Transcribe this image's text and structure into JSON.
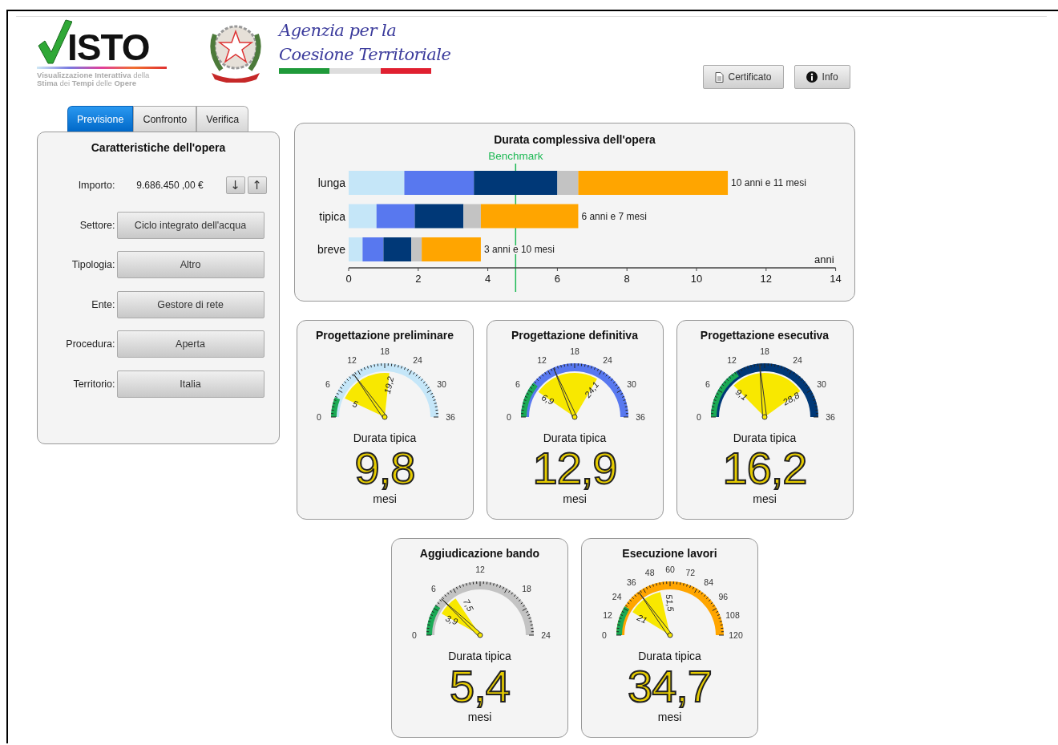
{
  "header": {
    "logo": {
      "wordmark": "ISTO",
      "lines": [
        "**Visualizzazione Interattiva** della",
        "**Stima** dei **Tempi** delle **Opere**"
      ]
    },
    "agency": [
      "Agenzia per la",
      "Coesione Territoriale"
    ],
    "buttons": [
      {
        "label": "Certificato"
      },
      {
        "label": "Info"
      }
    ]
  },
  "tabs": [
    {
      "label": "Previsione",
      "selected": true
    },
    {
      "label": "Confronto",
      "selected": false
    },
    {
      "label": "Verifica",
      "selected": false
    }
  ],
  "panel": {
    "title": "Caratteristiche dell'opera",
    "fields": [
      {
        "kind": "amount",
        "label": "Importo:",
        "value": "9.686.450 ,00 €",
        "steppers": [
          "↓",
          "↑"
        ]
      },
      {
        "kind": "select",
        "label": "Settore:",
        "value": "Ciclo integrato dell'acqua"
      },
      {
        "kind": "select",
        "label": "Tipologia:",
        "value": "Altro"
      },
      {
        "kind": "select",
        "label": "Ente:",
        "value": "Gestore di rete"
      },
      {
        "kind": "select",
        "label": "Procedura:",
        "value": "Aperta"
      },
      {
        "kind": "select",
        "label": "Territorio:",
        "value": "Italia"
      }
    ]
  },
  "overview": {
    "title": "Durata complessiva dell'opera",
    "chart_data": {
      "type": "bar",
      "orientation": "horizontal",
      "stacked": true,
      "xlabel": "anni",
      "categories": [
        "lunga",
        "tipica",
        "breve"
      ],
      "xlim": [
        0,
        14
      ],
      "xticks": [
        0,
        2,
        4,
        6,
        8,
        10,
        12,
        14
      ],
      "series": [
        {
          "color": "#c5e6f8",
          "values": [
            1.6,
            0.8,
            0.4
          ]
        },
        {
          "color": "#5878ef",
          "values": [
            2.0,
            1.1,
            0.6
          ]
        },
        {
          "color": "#003877",
          "values": [
            2.4,
            1.4,
            0.8
          ]
        },
        {
          "color": "#c3c3c3",
          "values": [
            0.6,
            0.5,
            0.3
          ]
        },
        {
          "color": "#ffa500",
          "values": [
            4.3,
            2.8,
            1.7
          ]
        }
      ],
      "value_labels": [
        "10 anni e 11 mesi",
        "6 anni e 7 mesi",
        "3 anni e 10 mesi"
      ],
      "ref_lines": [
        {
          "axis": "x",
          "value": 4.8,
          "label": "Benchmark"
        }
      ]
    }
  },
  "gauges": [
    {
      "title": "Progettazione preliminare",
      "color": "#c5e6f8",
      "ticks": [
        "0",
        "6",
        "12",
        "18",
        "24",
        "30",
        "36"
      ],
      "range": [
        "5",
        "19,2"
      ],
      "caption": "Durata tipica",
      "value": "9,8",
      "unit": "mesi"
    },
    {
      "title": "Progettazione definitiva",
      "color": "#5878ef",
      "ticks": [
        "0",
        "6",
        "12",
        "18",
        "24",
        "30",
        "36"
      ],
      "range": [
        "6,9",
        "24,1"
      ],
      "caption": "Durata tipica",
      "value": "12,9",
      "unit": "mesi"
    },
    {
      "title": "Progettazione esecutiva",
      "color": "#003877",
      "ticks": [
        "0",
        "6",
        "12",
        "18",
        "24",
        "30",
        "36"
      ],
      "range": [
        "9,1",
        "28,8"
      ],
      "caption": "Durata tipica",
      "value": "16,2",
      "unit": "mesi"
    },
    {
      "title": "Aggiudicazione bando",
      "color": "#c3c3c3",
      "ticks": [
        "0",
        "6",
        "12",
        "18",
        "24"
      ],
      "range": [
        "3,9",
        "7,5"
      ],
      "caption": "Durata tipica",
      "value": "5,4",
      "unit": "mesi"
    },
    {
      "title": "Esecuzione lavori",
      "color": "#ffa500",
      "ticks": [
        "0",
        "12",
        "24",
        "36",
        "48",
        "60",
        "72",
        "84",
        "96",
        "108",
        "120"
      ],
      "range": [
        "21",
        "51,5"
      ],
      "caption": "Durata tipica",
      "value": "34,7",
      "unit": "mesi"
    }
  ]
}
